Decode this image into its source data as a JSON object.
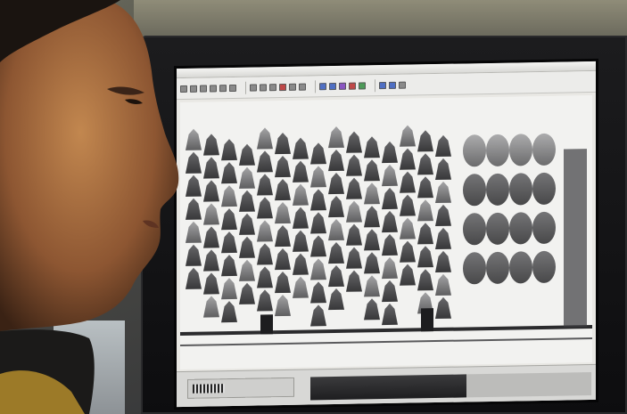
{
  "scene": {
    "description_tags": [
      "person",
      "monitor",
      "x-ray-scan"
    ],
    "colors": {
      "screen_bg": "#e9e8e4",
      "scan_bg": "#f2f2f0",
      "object_dark": "#2b2b2d",
      "skin": "#a0673f",
      "monitor_bezel": "#121214"
    }
  },
  "toolbar": {
    "buttons": [
      {
        "icon": "tool-icon"
      },
      {
        "icon": "tool-icon"
      },
      {
        "icon": "tool-icon"
      },
      {
        "icon": "tool-icon"
      },
      {
        "icon": "tool-icon"
      },
      {
        "icon": "tool-icon"
      },
      {
        "icon": "tool-icon"
      },
      {
        "icon": "tool-icon"
      },
      {
        "icon": "tool-icon"
      },
      {
        "icon": "tool-icon"
      },
      {
        "icon": "tool-icon"
      },
      {
        "icon": "tool-icon"
      },
      {
        "icon": "color-palette-icon"
      },
      {
        "icon": "color-palette-icon"
      },
      {
        "icon": "color-palette-icon"
      },
      {
        "icon": "color-palette-icon"
      },
      {
        "icon": "color-palette-icon"
      },
      {
        "icon": "zoom-icon"
      },
      {
        "icon": "zoom-icon"
      },
      {
        "icon": "settings-icon"
      }
    ]
  }
}
